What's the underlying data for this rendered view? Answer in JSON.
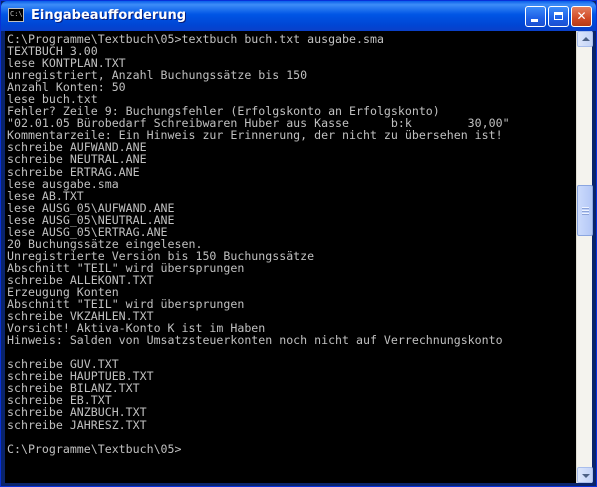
{
  "window": {
    "title": "Eingabeaufforderung",
    "icon_text": "C:\\",
    "icon": "console-icon",
    "buttons": {
      "minimize": "minimize-icon",
      "maximize": "maximize-icon",
      "close": "✕"
    }
  },
  "console": {
    "text": "C:\\Programme\\Textbuch\\05>textbuch buch.txt ausgabe.sma\nTEXTBUCH 3.00\nlese KONTPLAN.TXT\nunregistriert, Anzahl Buchungssätze bis 150\nAnzahl Konten: 50\nlese buch.txt\nFehler? Zeile 9: Buchungsfehler (Erfolgskonto an Erfolgskonto)\n\"02.01.05 Bürobedarf Schreibwaren Huber aus Kasse      b:k        30,00\"\nKommentarzeile: Ein Hinweis zur Erinnerung, der nicht zu übersehen ist!\nschreibe AUFWAND.ANE\nschreibe NEUTRAL.ANE\nschreibe ERTRAG.ANE\nlese ausgabe.sma\nlese AB.TXT\nlese AUSG_05\\AUFWAND.ANE\nlese AUSG_05\\NEUTRAL.ANE\nlese AUSG_05\\ERTRAG.ANE\n20 Buchungssätze eingelesen.\nUnregistrierte Version bis 150 Buchungssätze\nAbschnitt \"TEIL\" wird übersprungen\nschreibe ALLEKONT.TXT\nErzeugung Konten\nAbschnitt \"TEIL\" wird übersprungen\nschreibe VKZAHLEN.TXT\nVorsicht! Aktiva-Konto K ist im Haben\nHinweis: Salden von Umsatzsteuerkonten noch nicht auf Verrechnungskonto\n\nschreibe GUV.TXT\nschreibe HAUPTUEB.TXT\nschreibe BILANZ.TXT\nschreibe EB.TXT\nschreibe ANZBUCH.TXT\nschreibe JAHRESZ.TXT\n\nC:\\Programme\\Textbuch\\05>"
  },
  "scrollbar": {
    "up": "scroll-up-icon",
    "down": "scroll-down-icon",
    "position": 0.35
  },
  "colors": {
    "console_bg": "#000000",
    "console_fg": "#C0C0C0",
    "title_bar": "#0055E5"
  }
}
